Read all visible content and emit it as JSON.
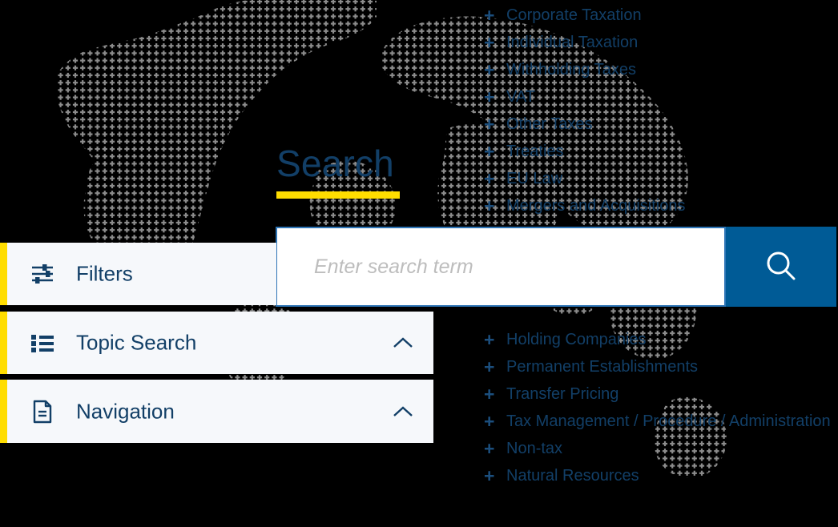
{
  "hero": {
    "title": "Search"
  },
  "search": {
    "placeholder": "Enter search term",
    "value": "",
    "button_icon": "search-icon",
    "button_color": "#005B96",
    "border_color": "#2E75B6"
  },
  "accordion": {
    "items": [
      {
        "id": "filters",
        "label": "Filters",
        "icon": "sliders-icon",
        "chevron": "",
        "accent_color": "#FFDD00"
      },
      {
        "id": "topic-search",
        "label": "Topic Search",
        "icon": "list-icon",
        "chevron": "chevron-up-icon",
        "accent_color": "#FFDD00"
      },
      {
        "id": "navigation",
        "label": "Navigation",
        "icon": "document-icon",
        "chevron": "chevron-up-icon",
        "accent_color": "#FFDD00"
      }
    ]
  },
  "topics": {
    "expander_symbol": "+",
    "top_group": [
      {
        "label": "Corporate Taxation"
      },
      {
        "label": "Individual Taxation"
      },
      {
        "label": "Withholding Taxes"
      },
      {
        "label": "VAT"
      },
      {
        "label": "Other Taxes"
      },
      {
        "label": "Treaties"
      },
      {
        "label": "EU Law"
      },
      {
        "label": "Mergers and Acquisitions"
      }
    ],
    "bottom_group": [
      {
        "label": "Holding Companies"
      },
      {
        "label": "Permanent Establishments"
      },
      {
        "label": "Transfer Pricing"
      },
      {
        "label": "Tax Management /  Procedure / Administration"
      },
      {
        "label": "Non-tax"
      },
      {
        "label": "Natural Resources"
      }
    ]
  },
  "theme": {
    "background": "#000000",
    "panel_background": "#F6F8FB",
    "navy": "#123F67",
    "link_blue": "#1B4E7D",
    "yellow": "#FFDD00",
    "map_dot": "#8C8C8C"
  }
}
